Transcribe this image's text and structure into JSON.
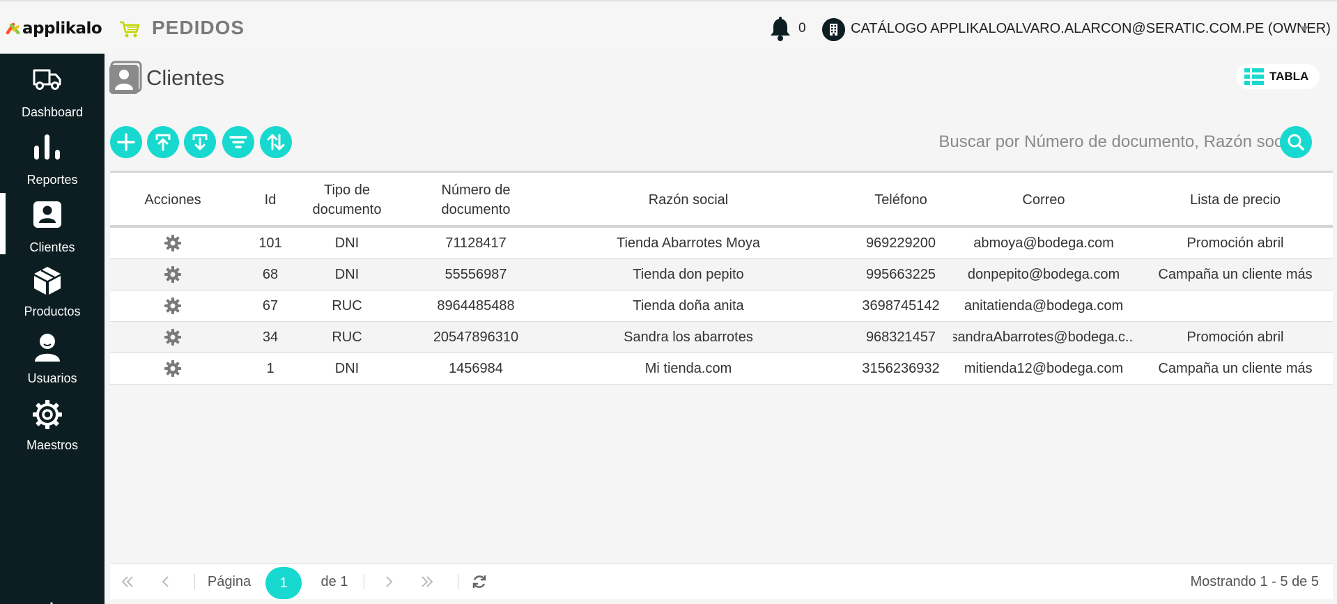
{
  "topbar": {
    "logo_text": "applikalo",
    "app_title": "PEDIDOS",
    "notification_count": "0",
    "catalog_label": "CATÁLOGO APPLIKALO",
    "user_label": "ALVARO.ALARCON@SERATIC.COM.PE (OWNER)"
  },
  "sidebar": {
    "items": [
      {
        "label": "Dashboard",
        "icon": "truck-icon"
      },
      {
        "label": "Reportes",
        "icon": "bar-chart-icon"
      },
      {
        "label": "Clientes",
        "icon": "contact-card-icon",
        "active": true
      },
      {
        "label": "Productos",
        "icon": "box-icon"
      },
      {
        "label": "Usuarios",
        "icon": "user-icon"
      },
      {
        "label": "Maestros",
        "icon": "gear-icon"
      }
    ]
  },
  "page": {
    "title": "Clientes",
    "view_label": "TABLA"
  },
  "search": {
    "placeholder": "Buscar por Número de documento, Razón social"
  },
  "table": {
    "headers": {
      "actions": "Acciones",
      "id": "Id",
      "doc_type": "Tipo de documento",
      "doc_number": "Número de documento",
      "business_name": "Razón social",
      "phone": "Teléfono",
      "email": "Correo",
      "price_list": "Lista de precio"
    },
    "rows": [
      {
        "id": "101",
        "doc_type": "DNI",
        "doc_number": "71128417",
        "business_name": "Tienda Abarrotes Moya",
        "phone": "969229200",
        "email": "abmoya@bodega.com",
        "price_list": "Promoción abril"
      },
      {
        "id": "68",
        "doc_type": "DNI",
        "doc_number": "55556987",
        "business_name": "Tienda don pepito",
        "phone": "995663225",
        "email": "donpepito@bodega.com",
        "price_list": "Campaña un cliente más"
      },
      {
        "id": "67",
        "doc_type": "RUC",
        "doc_number": "8964485488",
        "business_name": "Tienda doña anita",
        "phone": "3698745142",
        "email": "anitatienda@bodega.com",
        "price_list": ""
      },
      {
        "id": "34",
        "doc_type": "RUC",
        "doc_number": "20547896310",
        "business_name": "Sandra los abarrotes",
        "phone": "968321457",
        "email": "sandraAbarrotes@bodega.c...",
        "price_list": "Promoción abril"
      },
      {
        "id": "1",
        "doc_type": "DNI",
        "doc_number": "1456984",
        "business_name": "Mi tienda.com",
        "phone": "3156236932",
        "email": "mitienda12@bodega.com",
        "price_list": "Campaña un cliente más"
      }
    ]
  },
  "pager": {
    "page_label": "Página",
    "current_page": "1",
    "of_label": "de 1",
    "info": "Mostrando 1 - 5 de 5"
  },
  "colors": {
    "accent": "#17d9cf",
    "sidebar": "#0d1e22"
  }
}
